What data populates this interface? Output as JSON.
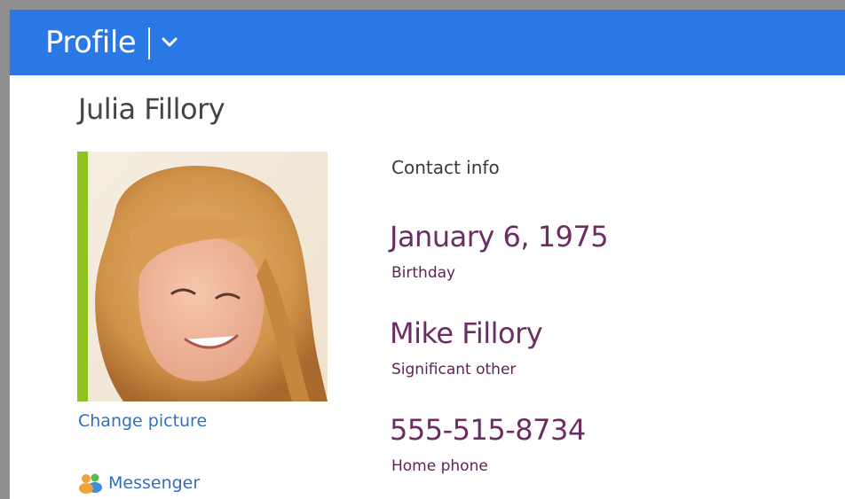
{
  "header": {
    "title": "Profile",
    "menu_icon": "chevron-down-icon",
    "bg_color": "#2a78e6"
  },
  "profile": {
    "name": "Julia Fillory",
    "photo_accent_color": "#8dc21f",
    "change_picture_label": "Change picture",
    "messenger_label": "Messenger",
    "messenger_icon": "people-icon"
  },
  "contact_info": {
    "title": "Contact info",
    "fields": [
      {
        "value": "January 6, 1975",
        "label": "Birthday"
      },
      {
        "value": "Mike Fillory",
        "label": "Significant other"
      },
      {
        "value": "555-515-8734",
        "label": "Home phone"
      }
    ]
  }
}
